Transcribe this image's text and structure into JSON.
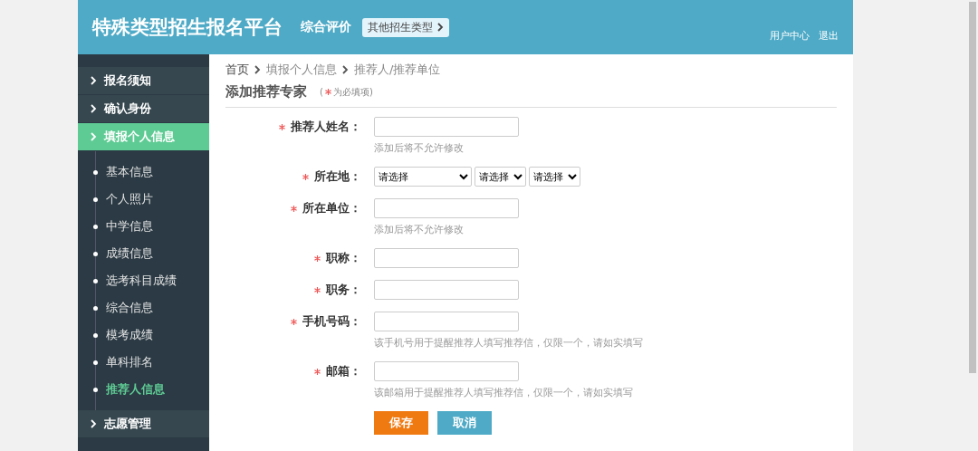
{
  "header": {
    "title": "特殊类型招生报名平台",
    "subtitle": "综合评价",
    "switch_button": "其他招生类型",
    "links": [
      "用户中心",
      "退出"
    ]
  },
  "sidebar": {
    "items": [
      {
        "label": "报名须知",
        "selected": false
      },
      {
        "label": "确认身份",
        "selected": false
      },
      {
        "label": "填报个人信息",
        "selected": true,
        "children": [
          {
            "label": "基本信息",
            "selected": false
          },
          {
            "label": "个人照片",
            "selected": false
          },
          {
            "label": "中学信息",
            "selected": false
          },
          {
            "label": "成绩信息",
            "selected": false
          },
          {
            "label": "选考科目成绩",
            "selected": false
          },
          {
            "label": "综合信息",
            "selected": false
          },
          {
            "label": "模考成绩",
            "selected": false
          },
          {
            "label": "单科排名",
            "selected": false
          },
          {
            "label": "推荐人信息",
            "selected": true
          }
        ]
      },
      {
        "label": "志愿管理",
        "selected": false
      }
    ]
  },
  "breadcrumb": [
    "首页",
    "填报个人信息",
    "推荐人/推荐单位"
  ],
  "heading": "添加推荐专家",
  "required_note": {
    "open": "(",
    "text": "为必填项)"
  },
  "fields": [
    {
      "kind": "text",
      "label": "推荐人姓名：",
      "required": true,
      "hint": "添加后将不允许修改"
    },
    {
      "kind": "select",
      "label": "所在地：",
      "required": true,
      "selects": [
        "请选择",
        "请选择",
        "请选择"
      ]
    },
    {
      "kind": "text",
      "label": "所在单位：",
      "required": true,
      "hint": "添加后将不允许修改"
    },
    {
      "kind": "text",
      "label": "职称：",
      "required": true
    },
    {
      "kind": "text",
      "label": "职务：",
      "required": true
    },
    {
      "kind": "text",
      "label": "手机号码：",
      "required": true,
      "hint": "该手机号用于提醒推荐人填写推荐信，仅限一个，请如实填写"
    },
    {
      "kind": "text",
      "label": "邮箱：",
      "required": true,
      "hint": "该邮箱用于提醒推荐人填写推荐信，仅限一个，请如实填写"
    }
  ],
  "buttons": [
    {
      "kind": "primary",
      "label": "保存"
    },
    {
      "kind": "secondary",
      "label": "取消"
    }
  ]
}
